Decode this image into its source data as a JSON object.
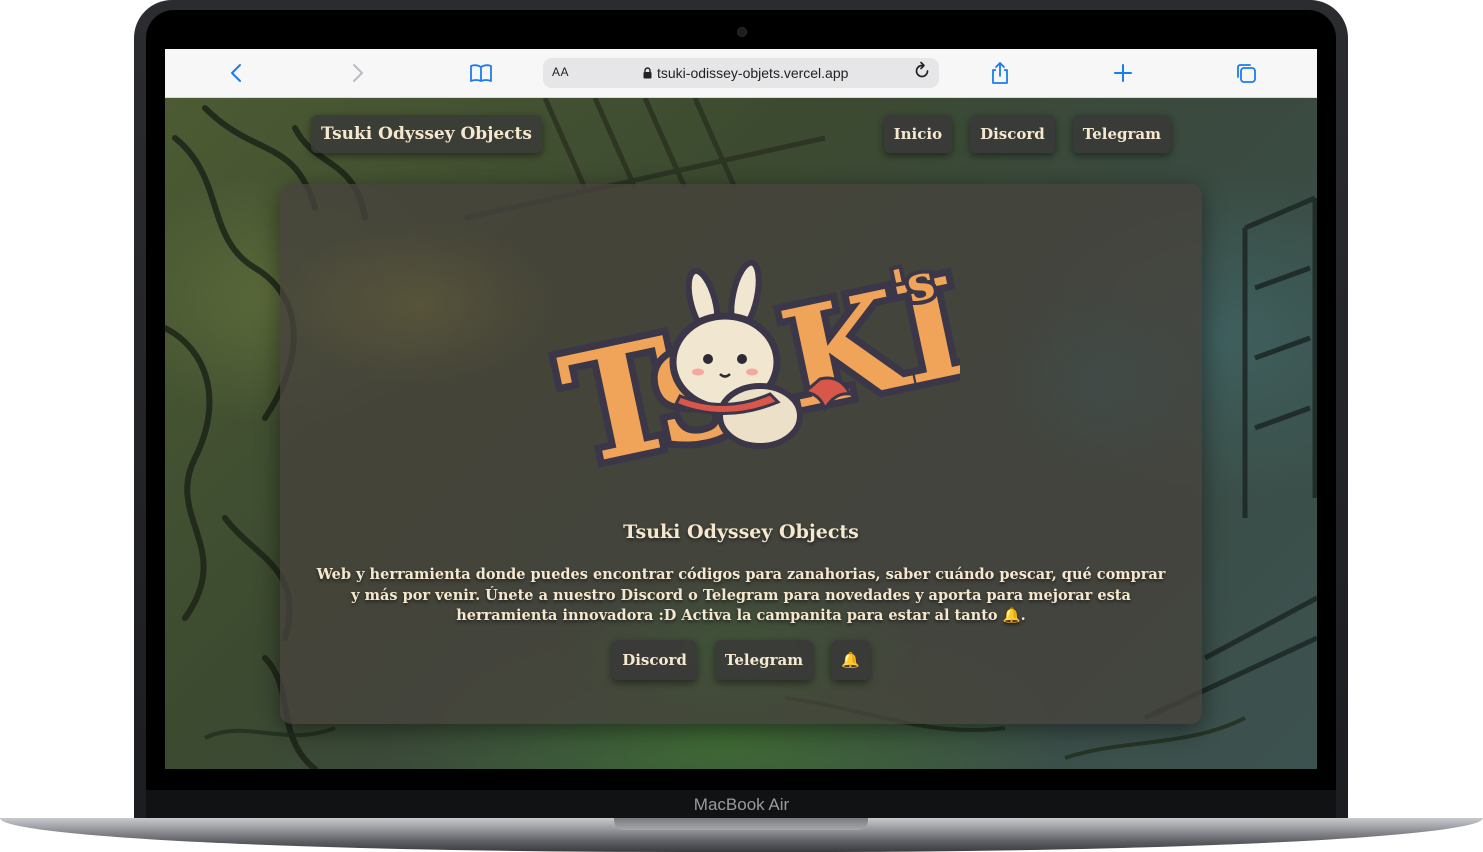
{
  "device": {
    "model_label": "MacBook Air"
  },
  "browser": {
    "back_icon": "chevron-left-icon",
    "forward_icon": "chevron-right-icon",
    "bookmarks_icon": "book-icon",
    "reader_label": "AA",
    "lock_icon": "lock-icon",
    "url": "tsuki-odissey-objets.vercel.app",
    "reload_icon": "reload-icon",
    "share_icon": "share-icon",
    "new_tab_icon": "plus-icon",
    "tabs_icon": "tabs-icon",
    "accent_color": "#1a7cf0"
  },
  "nav": {
    "brand": "Tsuki Odyssey Objects",
    "links": [
      {
        "label": "Inicio"
      },
      {
        "label": "Discord"
      },
      {
        "label": "Telegram"
      }
    ]
  },
  "hero": {
    "logo_text": "TSUKI'S",
    "title": "Tsuki Odyssey Objects",
    "description": "Web y herramienta donde puedes encontrar códigos para zanahorias, saber cuándo pescar, qué comprar y más por venir. Únete a nuestro Discord o Telegram para novedades y aporta para mejorar esta herramienta innovadora :D Activa la campanita para estar al tanto 🔔.",
    "actions": [
      {
        "label": "Discord"
      },
      {
        "label": "Telegram"
      },
      {
        "label": "🔔",
        "icon": "bell-icon"
      }
    ],
    "text_color": "#f5e8cf",
    "logo_color": "#f0a45a"
  }
}
